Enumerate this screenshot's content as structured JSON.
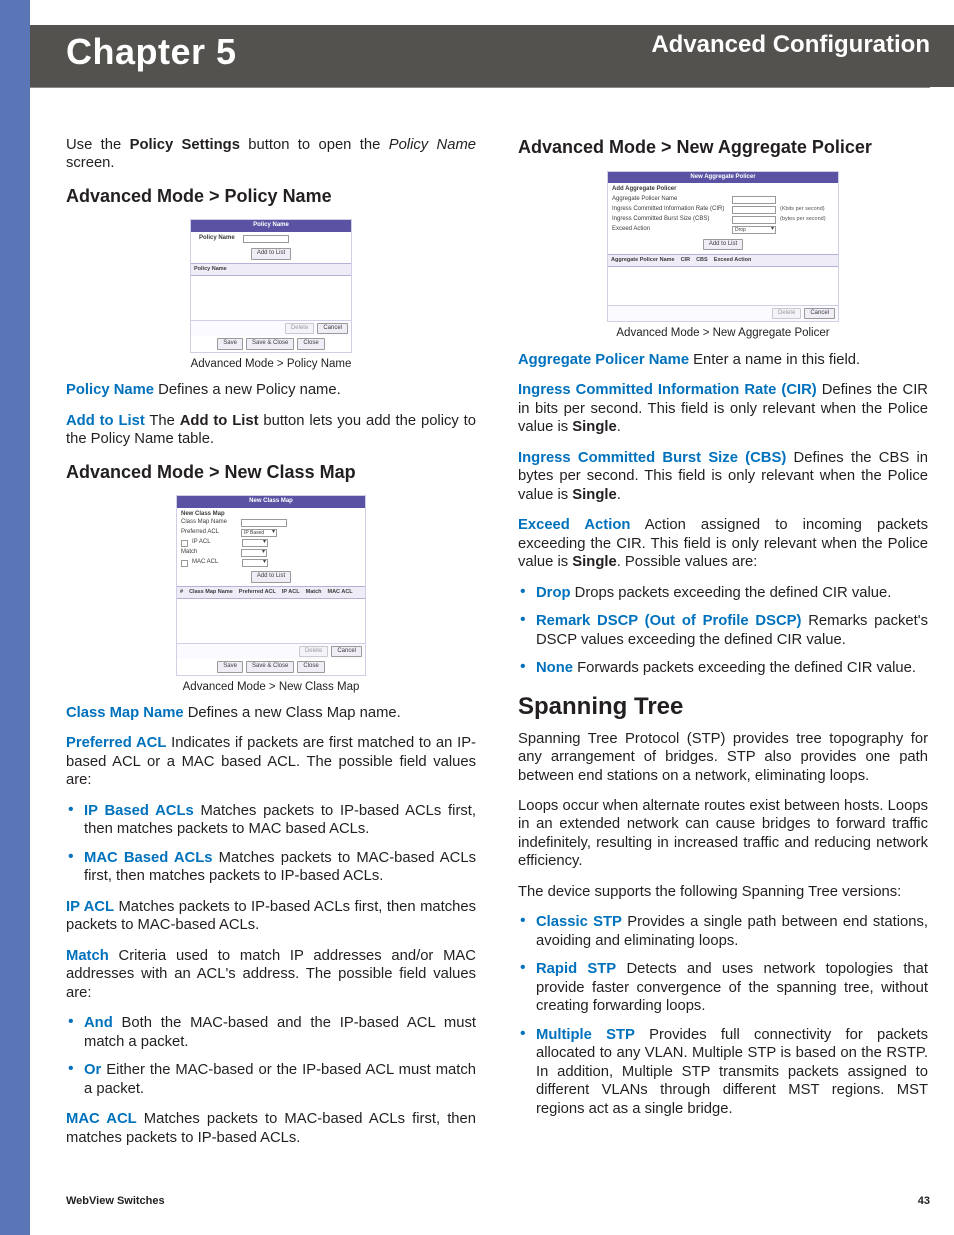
{
  "header": {
    "chapter": "Chapter 5",
    "section": "Advanced Configuration"
  },
  "left": {
    "intro_pre": "Use the ",
    "intro_bold": "Policy Settings",
    "intro_mid": " button to open the ",
    "intro_ital": "Policy Name",
    "intro_post": " screen.",
    "h_policy": "Advanced Mode > Policy Name",
    "cap_policy": "Advanced Mode > Policy Name",
    "policy_name_term": "Policy Name",
    "policy_name_txt": "  Defines a new Policy name.",
    "add_to_list_term": "Add to List",
    "add_to_list_pre": "  The ",
    "add_to_list_bold": "Add to List",
    "add_to_list_post": " button lets you add the policy to the Policy Name table.",
    "h_classmap": "Advanced Mode > New Class Map",
    "cap_classmap": "Advanced Mode > New Class Map",
    "cm_name_term": "Class Map Name",
    "cm_name_txt": "  Defines a new Class Map name.",
    "pref_acl_term": "Preferred ACL",
    "pref_acl_txt": "  Indicates if packets are first matched to an IP-based ACL or a MAC based ACL. The possible field values are:",
    "ip_based_term": "IP Based ACLs",
    "ip_based_txt": "  Matches packets to IP-based ACLs first, then matches packets to MAC based ACLs.",
    "mac_based_term": "MAC Based ACLs",
    "mac_based_txt": " Matches packets to MAC-based ACLs first, then matches packets to IP-based ACLs.",
    "ip_acl_term": "IP ACL",
    "ip_acl_txt": " Matches packets to IP-based ACLs first, then matches packets to MAC-based ACLs.",
    "match_term": "Match",
    "match_txt": "  Criteria used to match IP addresses and/or MAC addresses with an ACL's address. The possible field values are:",
    "and_term": "And",
    "and_txt": "  Both the MAC-based and the IP-based ACL must match a packet.",
    "or_term": "Or",
    "or_txt": "  Either the MAC-based or the IP-based ACL must match a packet.",
    "mac_acl_term": "MAC ACL",
    "mac_acl_txt": "  Matches packets to MAC-based ACLs first, then matches packets to IP-based ACLs."
  },
  "right": {
    "h_agg": "Advanced Mode > New Aggregate Policer",
    "cap_agg": "Advanced Mode > New Aggregate Policer",
    "agg_name_term": "Aggregate Policer Name",
    "agg_name_txt": "  Enter a name in this field.",
    "cir_term": "Ingress Committed Information Rate (CIR)",
    "cir_pre": "  Defines the CIR in bits per second. This field is only relevant when the Police value is ",
    "cir_bold": "Single",
    "cir_post": ".",
    "cbs_term": "Ingress Committed Burst Size (CBS)",
    "cbs_pre": " Defines the CBS in bytes per second. This field is only relevant when the Police value is ",
    "cbs_bold": "Single",
    "cbs_post": ".",
    "exceed_term": "Exceed Action",
    "exceed_pre": " Action assigned to incoming packets exceeding the CIR. This field is only relevant when the Police value is ",
    "exceed_bold": "Single",
    "exceed_post": ". Possible values are:",
    "drop_term": "Drop",
    "drop_txt": "  Drops packets exceeding the defined CIR value.",
    "remark_term": "Remark DSCP (Out of Profile DSCP)",
    "remark_txt": "  Remarks packet's DSCP values exceeding the defined CIR value.",
    "none_term": "None",
    "none_txt": "  Forwards packets exceeding the defined CIR value.",
    "h_span": "Spanning Tree",
    "span_p1": "Spanning Tree Protocol (STP) provides tree topography for any arrangement of bridges. STP also provides one path between end stations on a network, eliminating loops.",
    "span_p2": "Loops occur when alternate routes exist between hosts. Loops in an extended network can cause bridges to forward traffic indefinitely, resulting in increased traffic and reducing network efficiency.",
    "span_p3": "The device supports the following Spanning Tree versions:",
    "cstp_term": "Classic STP",
    "cstp_txt": " Provides a single path between end stations, avoiding and eliminating loops.",
    "rstp_term": "Rapid STP",
    "rstp_txt": " Detects and uses network topologies that provide faster convergence of the spanning tree, without creating forwarding loops.",
    "mstp_term": "Multiple STP",
    "mstp_txt": " Provides full connectivity for packets allocated to any VLAN. Multiple STP is based on the RSTP. In addition, Multiple STP transmits packets assigned to different VLANs through different MST regions. MST regions act as a single bridge."
  },
  "mini_policy": {
    "title": "Policy Name",
    "lbl": "Policy Name",
    "addbtn": "Add to List",
    "col1": "Policy Name",
    "del": "Delete",
    "cancel": "Cancel",
    "save": "Save",
    "saveclose": "Save & Close",
    "close": "Close"
  },
  "mini_classmap": {
    "title": "New Class Map",
    "sec": "New Class Map",
    "l_name": "Class Map Name",
    "l_pref": "Preferred ACL",
    "pref_val": "IP Based",
    "l_ipacl": "IP ACL",
    "l_match": "Match",
    "l_macacl": "MAC ACL",
    "addbtn": "Add to List",
    "hc1": "#",
    "hc2": "Class Map Name",
    "hc3": "Preferred ACL",
    "hc4": "IP ACL",
    "hc5": "Match",
    "hc6": "MAC ACL",
    "del": "Delete",
    "cancel": "Cancel",
    "save": "Save",
    "saveclose": "Save & Close",
    "close": "Close"
  },
  "mini_agg": {
    "title": "New Aggregate Policer",
    "sec": "Add Aggregate Policer",
    "l_name": "Aggregate Policer Name",
    "l_cir": "Ingress Committed Information Rate (CIR)",
    "u_cir": "(Kbits per second)",
    "l_cbs": "Ingress Committed Burst Size (CBS)",
    "u_cbs": "(bytes per second)",
    "l_ex": "Exceed Action",
    "ex_val": "Drop",
    "addbtn": "Add to List",
    "hc1": "Aggregate Policer Name",
    "hc2": "CIR",
    "hc3": "CBS",
    "hc4": "Exceed Action",
    "del": "Delete",
    "cancel": "Cancel"
  },
  "footer": {
    "left": "WebView Switches",
    "right": "43"
  }
}
